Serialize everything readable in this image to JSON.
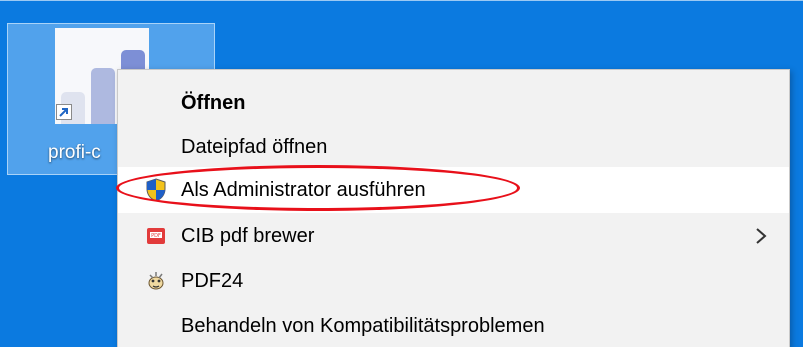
{
  "desktop": {
    "background_color": "#0b7ae0",
    "icon": {
      "label": "profi-c",
      "icon_name": "profi-chart-app-icon",
      "shortcut_icon": "shortcut-arrow-icon"
    }
  },
  "context_menu": {
    "items": [
      {
        "label": "Öffnen",
        "bold": true,
        "icon": null,
        "submenu": false,
        "hovered": false
      },
      {
        "label": "Dateipfad öffnen",
        "bold": false,
        "icon": null,
        "submenu": false,
        "hovered": false
      },
      {
        "label": "Als Administrator ausführen",
        "bold": false,
        "icon": "uac-shield-icon",
        "submenu": false,
        "hovered": true
      },
      {
        "label": "CIB pdf brewer",
        "bold": false,
        "icon": "pdf-brewer-icon",
        "submenu": true,
        "hovered": false
      },
      {
        "label": "PDF24",
        "bold": false,
        "icon": "pdf24-icon",
        "submenu": false,
        "hovered": false
      },
      {
        "label": "Behandeln von Kompatibilitätsproblemen",
        "bold": false,
        "icon": null,
        "submenu": false,
        "hovered": false
      }
    ]
  },
  "annotation": {
    "color": "#e8101a",
    "target": "Als Administrator ausführen"
  }
}
